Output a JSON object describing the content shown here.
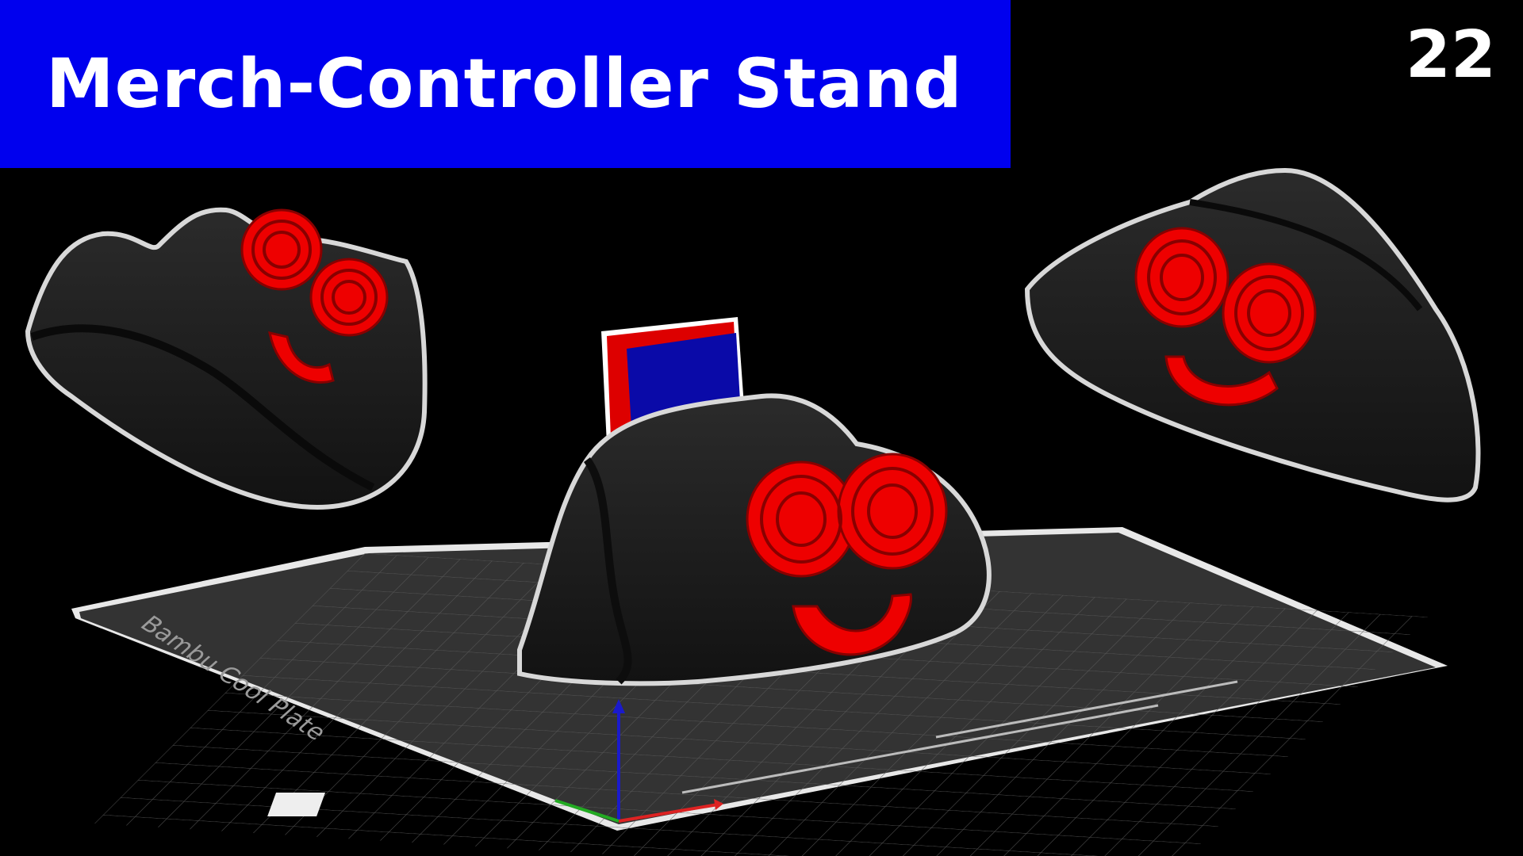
{
  "title": "Merch-Controller Stand",
  "episode_number": "22",
  "plate_label": "Bambu Cool Plate",
  "colors": {
    "banner": "#0000ee",
    "stand_body": "#1c1c1c",
    "face_accent": "#ee0000",
    "card_blue": "#0a0aa8",
    "card_red": "#dd0000",
    "plate_surface": "#3a3a3a",
    "outline": "#d8d8d8"
  },
  "icons": [
    "stand-model-left",
    "stand-model-center",
    "stand-model-right",
    "build-plate",
    "axis-gizmo"
  ]
}
